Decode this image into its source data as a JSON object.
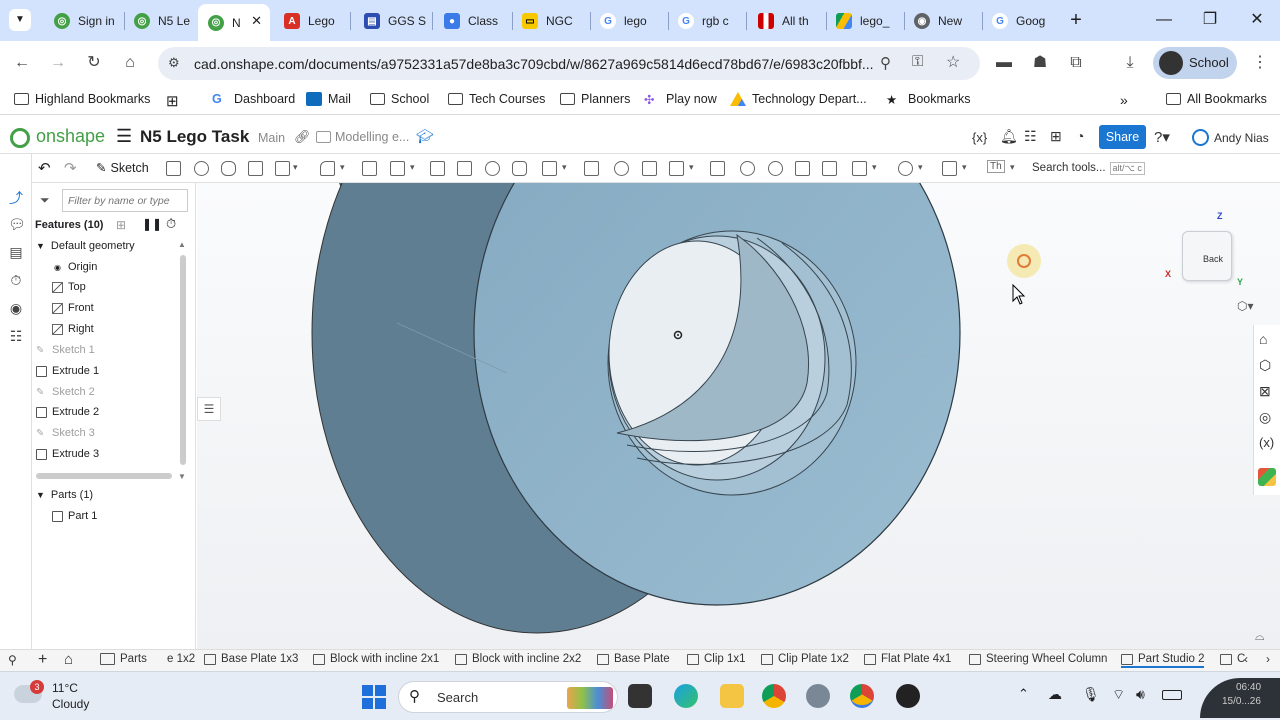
{
  "browser": {
    "tabs": [
      {
        "label": "Sign in",
        "icon": "onshape"
      },
      {
        "label": "N5 Le",
        "icon": "onshape"
      },
      {
        "label": "N",
        "icon": "onshape",
        "active": true
      },
      {
        "label": "Lego",
        "icon": "pdf"
      },
      {
        "label": "GGS S",
        "icon": "forms"
      },
      {
        "label": "Class",
        "icon": "classroom"
      },
      {
        "label": "NGC",
        "icon": "ngc"
      },
      {
        "label": "lego",
        "icon": "google"
      },
      {
        "label": "rgb c",
        "icon": "google"
      },
      {
        "label": "All th",
        "icon": "flag"
      },
      {
        "label": "lego_",
        "icon": "drive"
      },
      {
        "label": "New",
        "icon": "chrome"
      },
      {
        "label": "Goog",
        "icon": "google"
      }
    ],
    "url": "cad.onshape.com/documents/a9752331a57de8ba3c709cbd/w/8627a969c5814d6ecd78bd67/e/6983c20fbbf...",
    "profile_label": "School",
    "bookmarks": [
      {
        "label": "Highland Bookmarks",
        "icon": "folder"
      },
      {
        "label": "",
        "icon": "apps-grid"
      },
      {
        "label": "Dashboard",
        "icon": "google"
      },
      {
        "label": "Mail",
        "icon": "outlook"
      },
      {
        "label": "School",
        "icon": "folder"
      },
      {
        "label": "Tech Courses",
        "icon": "folder"
      },
      {
        "label": "Planners",
        "icon": "folder"
      },
      {
        "label": "Play now",
        "icon": "puzzle"
      },
      {
        "label": "Technology Depart...",
        "icon": "drive"
      },
      {
        "label": "Bookmarks",
        "icon": "star"
      }
    ],
    "all_bookmarks_label": "All Bookmarks"
  },
  "onshape": {
    "logo_text": "onshape",
    "doc_title": "N5 Lego Task",
    "branch": "Main",
    "folder": "Modelling e...",
    "share_label": "Share",
    "user_name": "Andy Nias",
    "sketch_label": "Sketch",
    "search_tools": "Search tools...",
    "search_shortcut": "alt/⌥ c",
    "th_label": "Th",
    "filter_placeholder": "Filter by name or type",
    "features_header": "Features (10)",
    "default_geometry": "Default geometry",
    "features": [
      {
        "label": "Origin",
        "kind": "origin"
      },
      {
        "label": "Top",
        "kind": "plane"
      },
      {
        "label": "Front",
        "kind": "plane"
      },
      {
        "label": "Right",
        "kind": "plane"
      },
      {
        "label": "Sketch 1",
        "kind": "sketch"
      },
      {
        "label": "Extrude 1",
        "kind": "extrude"
      },
      {
        "label": "Sketch 2",
        "kind": "sketch"
      },
      {
        "label": "Extrude 2",
        "kind": "extrude"
      },
      {
        "label": "Sketch 3",
        "kind": "sketch"
      },
      {
        "label": "Extrude 3",
        "kind": "extrude"
      }
    ],
    "parts_header": "Parts (1)",
    "parts": [
      "Part 1"
    ],
    "view_cube_label": "Back",
    "axis_z": "Z",
    "axis_x": "X",
    "axis_y": "Y",
    "bottom_tabs": [
      {
        "label": "Parts",
        "icon": "folder"
      },
      {
        "label": "e 1x2",
        "icon": "none"
      },
      {
        "label": "Base Plate 1x3",
        "icon": "part"
      },
      {
        "label": "Block with incline 2x1",
        "icon": "part"
      },
      {
        "label": "Block with incline 2x2",
        "icon": "part"
      },
      {
        "label": "Base Plate",
        "icon": "part"
      },
      {
        "label": "Clip 1x1",
        "icon": "part"
      },
      {
        "label": "Clip Plate 1x2",
        "icon": "part"
      },
      {
        "label": "Flat Plate 4x1",
        "icon": "part"
      },
      {
        "label": "Steering Wheel Column",
        "icon": "part"
      },
      {
        "label": "Part Studio 2",
        "icon": "part",
        "active": true
      },
      {
        "label": "C",
        "icon": "part"
      }
    ]
  },
  "taskbar": {
    "weather_temp": "11°C",
    "weather_desc": "Cloudy",
    "weather_badge": "3",
    "search_label": "Search",
    "clock_time": "06:40",
    "clock_date": "15/0...26"
  },
  "colors": {
    "tabstrip": "#d3e3fd",
    "onshape_green": "#43a047",
    "share_blue": "#1b76d2",
    "part_face": "#8fb0c6",
    "part_dark": "#5f7f95"
  }
}
